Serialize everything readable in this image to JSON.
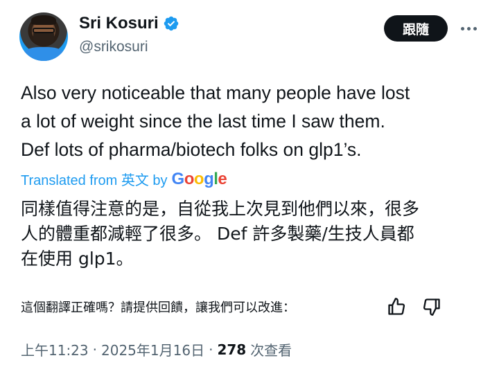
{
  "author": {
    "display_name": "Sri Kosuri",
    "handle": "@srikosuri",
    "verified": true
  },
  "actions": {
    "follow_label": "跟隨",
    "more_icon": "more-horizontal-icon"
  },
  "tweet": {
    "text": "Also very noticeable that many people have lost\na lot of weight since the last time I saw them.\nDef lots of pharma/biotech folks on glp1’s."
  },
  "translation": {
    "label": "Translated from 英文 by",
    "provider": "Google",
    "text": "同樣值得注意的是，自從我上次見到他們以來，很多\n人的體重都減輕了很多。 Def 許多製藥/生技人員都\n在使用 glp1。"
  },
  "feedback": {
    "prompt": "這個翻譯正確嗎？請提供回饋，讓我們可以改進：",
    "thumb_up_icon": "thumbs-up-icon",
    "thumb_down_icon": "thumbs-down-icon"
  },
  "meta": {
    "time": "上午11:23",
    "separator": "·",
    "date": "2025年1月16日",
    "views": "278",
    "views_label": "次查看"
  },
  "colors": {
    "link": "#1d9bf0",
    "text": "#0f1419",
    "secondary": "#536471",
    "button": "#0f1419"
  }
}
